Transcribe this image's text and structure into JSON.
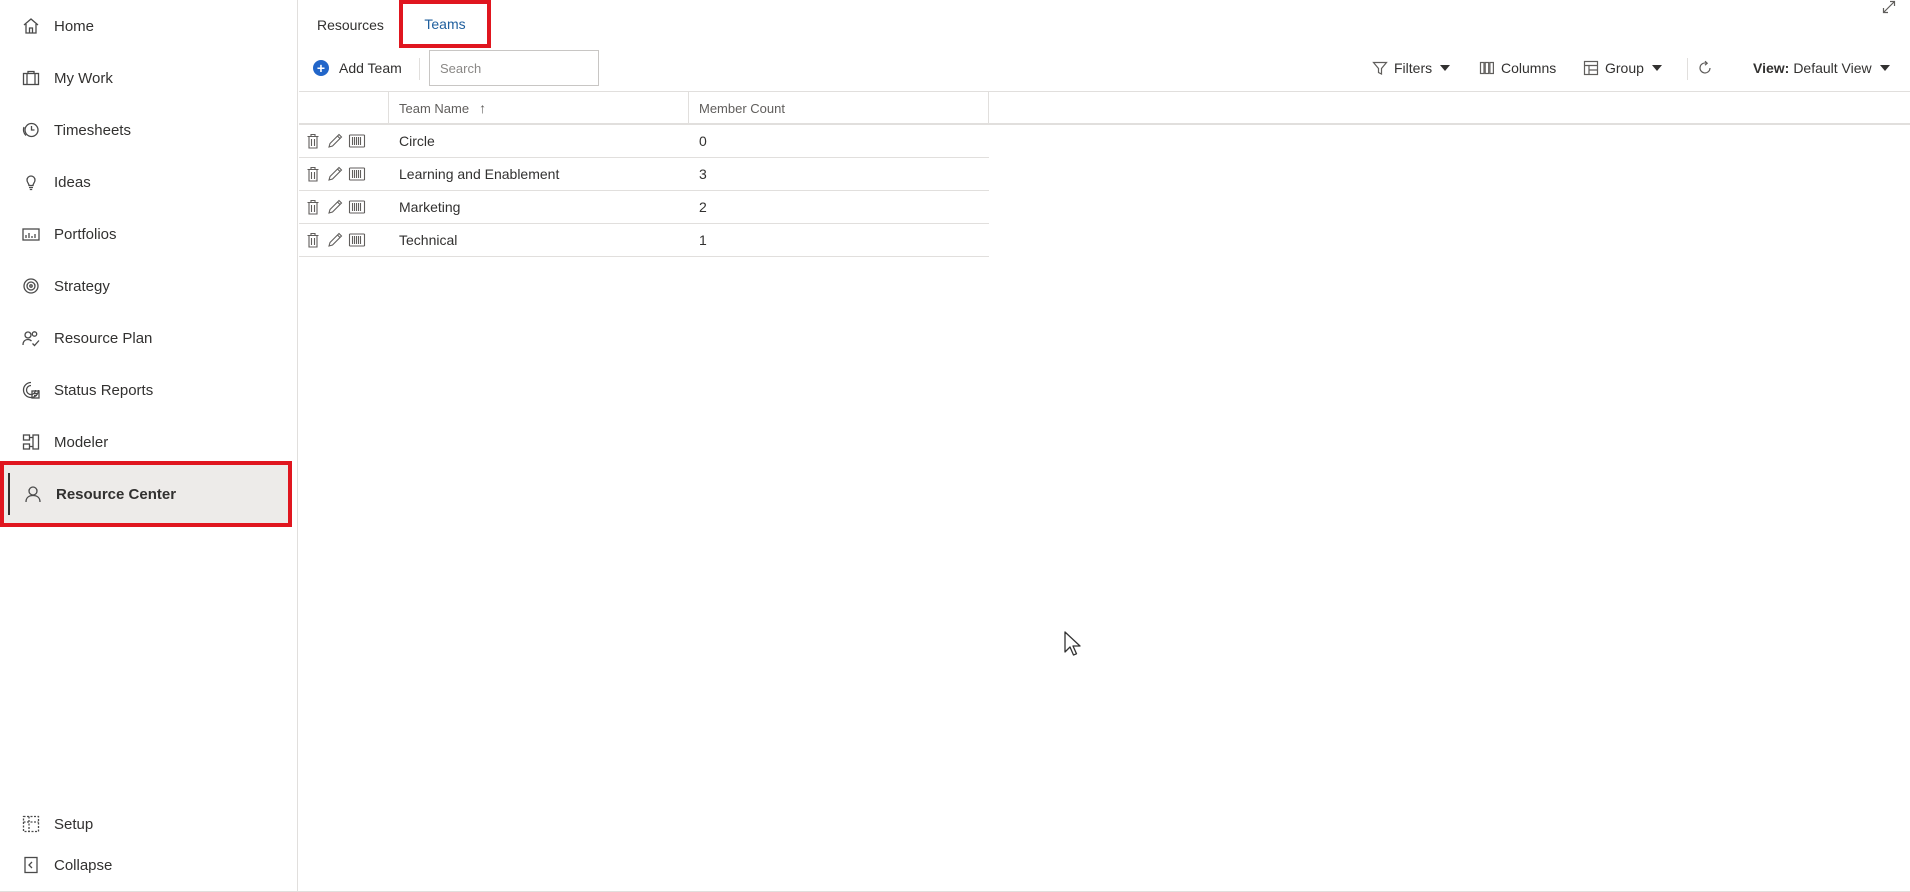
{
  "sidebar": {
    "items": [
      {
        "label": "Home",
        "icon": "home-icon"
      },
      {
        "label": "My Work",
        "icon": "briefcase-icon"
      },
      {
        "label": "Timesheets",
        "icon": "clock-icon"
      },
      {
        "label": "Ideas",
        "icon": "lightbulb-icon"
      },
      {
        "label": "Portfolios",
        "icon": "portfolio-chart-icon"
      },
      {
        "label": "Strategy",
        "icon": "target-icon"
      },
      {
        "label": "Resource Plan",
        "icon": "people-check-icon"
      },
      {
        "label": "Status Reports",
        "icon": "status-report-icon"
      },
      {
        "label": "Modeler",
        "icon": "modeler-icon"
      },
      {
        "label": "Resource Center",
        "icon": "person-icon",
        "active": true
      }
    ],
    "bottom": [
      {
        "label": "Setup",
        "icon": "setup-icon"
      },
      {
        "label": "Collapse",
        "icon": "collapse-icon"
      }
    ]
  },
  "tabs": [
    {
      "label": "Resources",
      "active": false
    },
    {
      "label": "Teams",
      "active": true
    }
  ],
  "toolbar": {
    "add_team_label": "Add Team",
    "search_placeholder": "Search",
    "filters_label": "Filters",
    "columns_label": "Columns",
    "group_label": "Group",
    "view_prefix": "View:",
    "view_value": "Default View"
  },
  "grid": {
    "columns": [
      {
        "label": "Team Name",
        "sorted": "ascending"
      },
      {
        "label": "Member Count"
      }
    ],
    "rows": [
      {
        "name": "Circle",
        "count": "0"
      },
      {
        "name": "Learning and Enablement",
        "count": "3"
      },
      {
        "name": "Marketing",
        "count": "2"
      },
      {
        "name": "Technical",
        "count": "1"
      }
    ]
  },
  "colors": {
    "accent": "#2266c9",
    "active_tab_text": "#1f5f9e",
    "highlight_box": "#e0161f"
  }
}
